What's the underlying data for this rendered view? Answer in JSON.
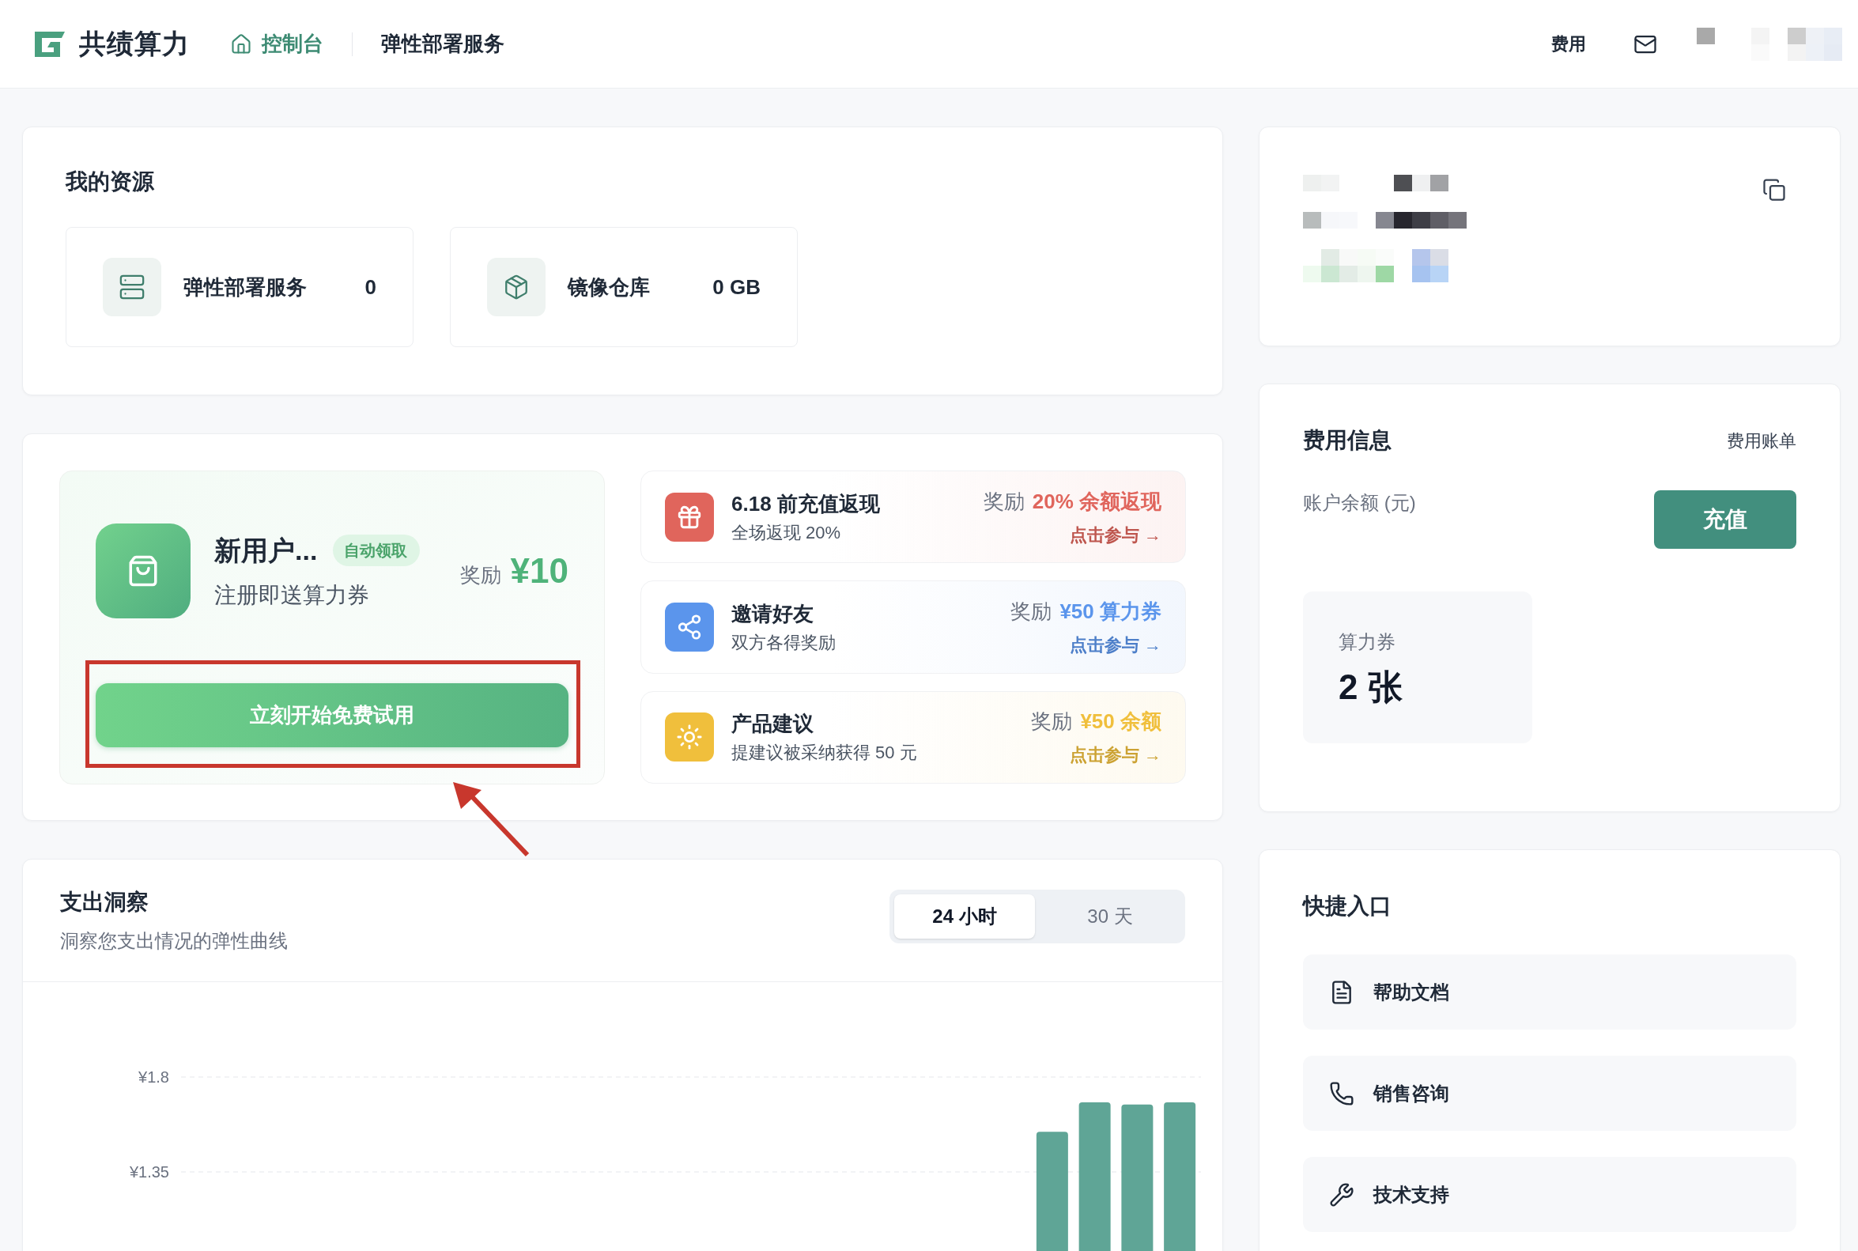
{
  "header": {
    "logo_text": "共绩算力",
    "nav": [
      {
        "label": "控制台",
        "selected": true
      },
      {
        "label": "弹性部署服务",
        "selected": false
      }
    ],
    "fee_link": "费用"
  },
  "resources": {
    "title": "我的资源",
    "items": [
      {
        "kind": "server",
        "label": "弹性部署服务",
        "value": "0"
      },
      {
        "kind": "package",
        "label": "镜像仓库",
        "value": "0 GB"
      }
    ]
  },
  "newcomer": {
    "title": "新用户...",
    "badge": "自动领取",
    "subtitle": "注册即送算力券",
    "reward_label": "奖励",
    "reward": "¥10",
    "button": "立刻开始免费试用"
  },
  "annotation": {
    "kind": "frame-arrow"
  },
  "promotions": [
    {
      "kind": "gift",
      "color": "#e0655c",
      "title": "6.18 前充值返现",
      "subtitle": "全场返现 20%",
      "reward_label": "奖励",
      "reward": "20% 余额返现",
      "link": "点击参与 →"
    },
    {
      "kind": "share",
      "color": "#5b95ec",
      "title": "邀请好友",
      "subtitle": "双方各得奖励",
      "reward_label": "奖励",
      "reward": "¥50 算力券",
      "link": "点击参与 →"
    },
    {
      "kind": "sun",
      "color": "#f0bf3c",
      "title": "产品建议",
      "subtitle": "提建议被采纳获得 50 元",
      "reward_label": "奖励",
      "reward": "¥50 余额",
      "link": "点击参与 →"
    }
  ],
  "spending": {
    "title": "支出洞察",
    "subtitle": "洞察您支出情况的弹性曲线",
    "tabs": [
      {
        "label": "24 小时",
        "selected": true
      },
      {
        "label": "30 天",
        "selected": false
      }
    ],
    "chart_data": {
      "type": "bar",
      "ylim": [
        0,
        1.8
      ],
      "yticks": [
        {
          "value": 1.35,
          "label": "¥1.35"
        },
        {
          "value": 1.8,
          "label": "¥1.8"
        }
      ],
      "values": [
        null,
        null,
        null,
        null,
        null,
        null,
        null,
        null,
        null,
        null,
        null,
        null,
        null,
        null,
        null,
        null,
        null,
        null,
        null,
        null,
        1.54,
        1.68,
        1.67,
        1.68
      ]
    }
  },
  "billing": {
    "title": "费用信息",
    "link": "费用账单",
    "balance_label": "账户余额 (元)",
    "recharge": "充值",
    "voucher_label": "算力券",
    "voucher_value": "2 张"
  },
  "shortcuts": {
    "title": "快捷入口",
    "items": [
      {
        "kind": "doc",
        "label": "帮助文档"
      },
      {
        "kind": "phone",
        "label": "销售咨询"
      },
      {
        "kind": "wrench",
        "label": "技术支持"
      }
    ]
  }
}
